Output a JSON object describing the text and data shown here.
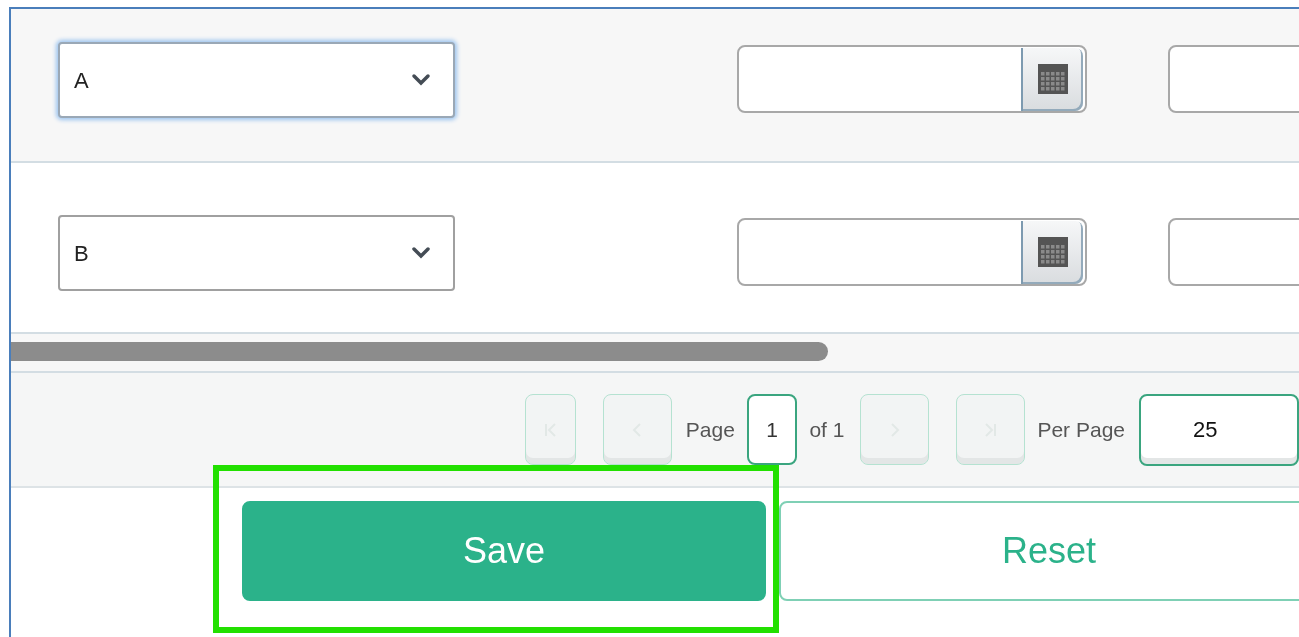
{
  "grid_rows": [
    {
      "select": "A",
      "focused": true
    },
    {
      "select": "B",
      "focused": false
    }
  ],
  "pager": {
    "first_disabled": true,
    "prev_disabled": true,
    "page_label": "Page",
    "page": "1",
    "of_label": "of 1",
    "next_disabled": true,
    "last_disabled": true,
    "per_page_label": "Per Page",
    "per_page": "25"
  },
  "actions": [
    {
      "label": "Save",
      "kind": "primary",
      "highlighted": true
    },
    {
      "label": "Reset",
      "kind": "secondary",
      "highlighted": false
    }
  ]
}
